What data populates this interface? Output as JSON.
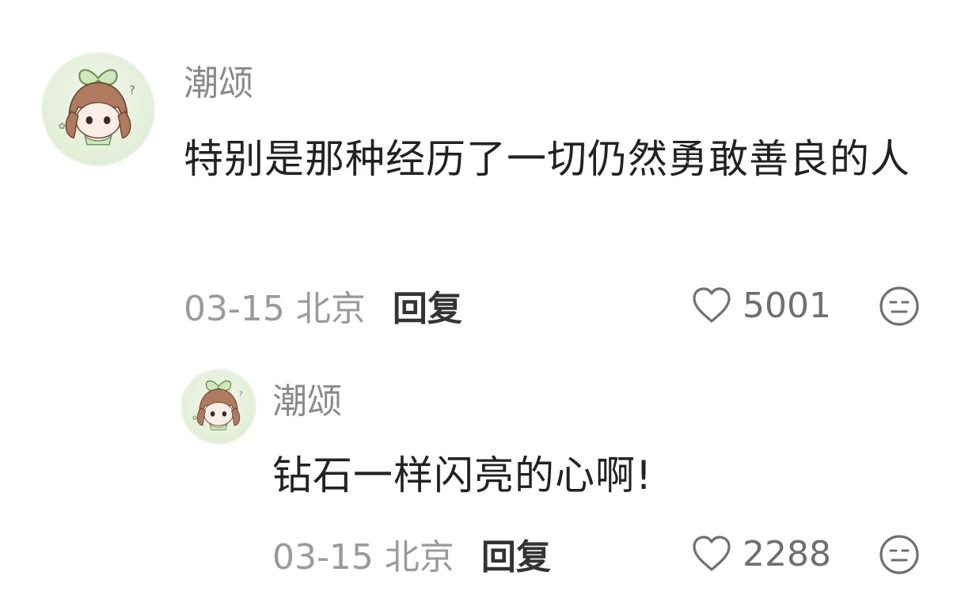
{
  "comments": [
    {
      "username": "潮颂",
      "content": "特别是那种经历了一切仍然勇敢善良的人",
      "date_location": "03-15 北京",
      "reply_label": "回复",
      "likes": "5001",
      "avatar_icon": "anime-girl-avatar"
    },
    {
      "username": "潮颂",
      "content": "钻石一样闪亮的心啊!",
      "date_location": "03-15 北京",
      "reply_label": "回复",
      "likes": "2288",
      "avatar_icon": "anime-girl-avatar"
    }
  ],
  "colors": {
    "username": "#8a8a8a",
    "content": "#222222",
    "meta": "#9a9a9a",
    "reply": "#333333",
    "icon": "#6f6f6f"
  }
}
